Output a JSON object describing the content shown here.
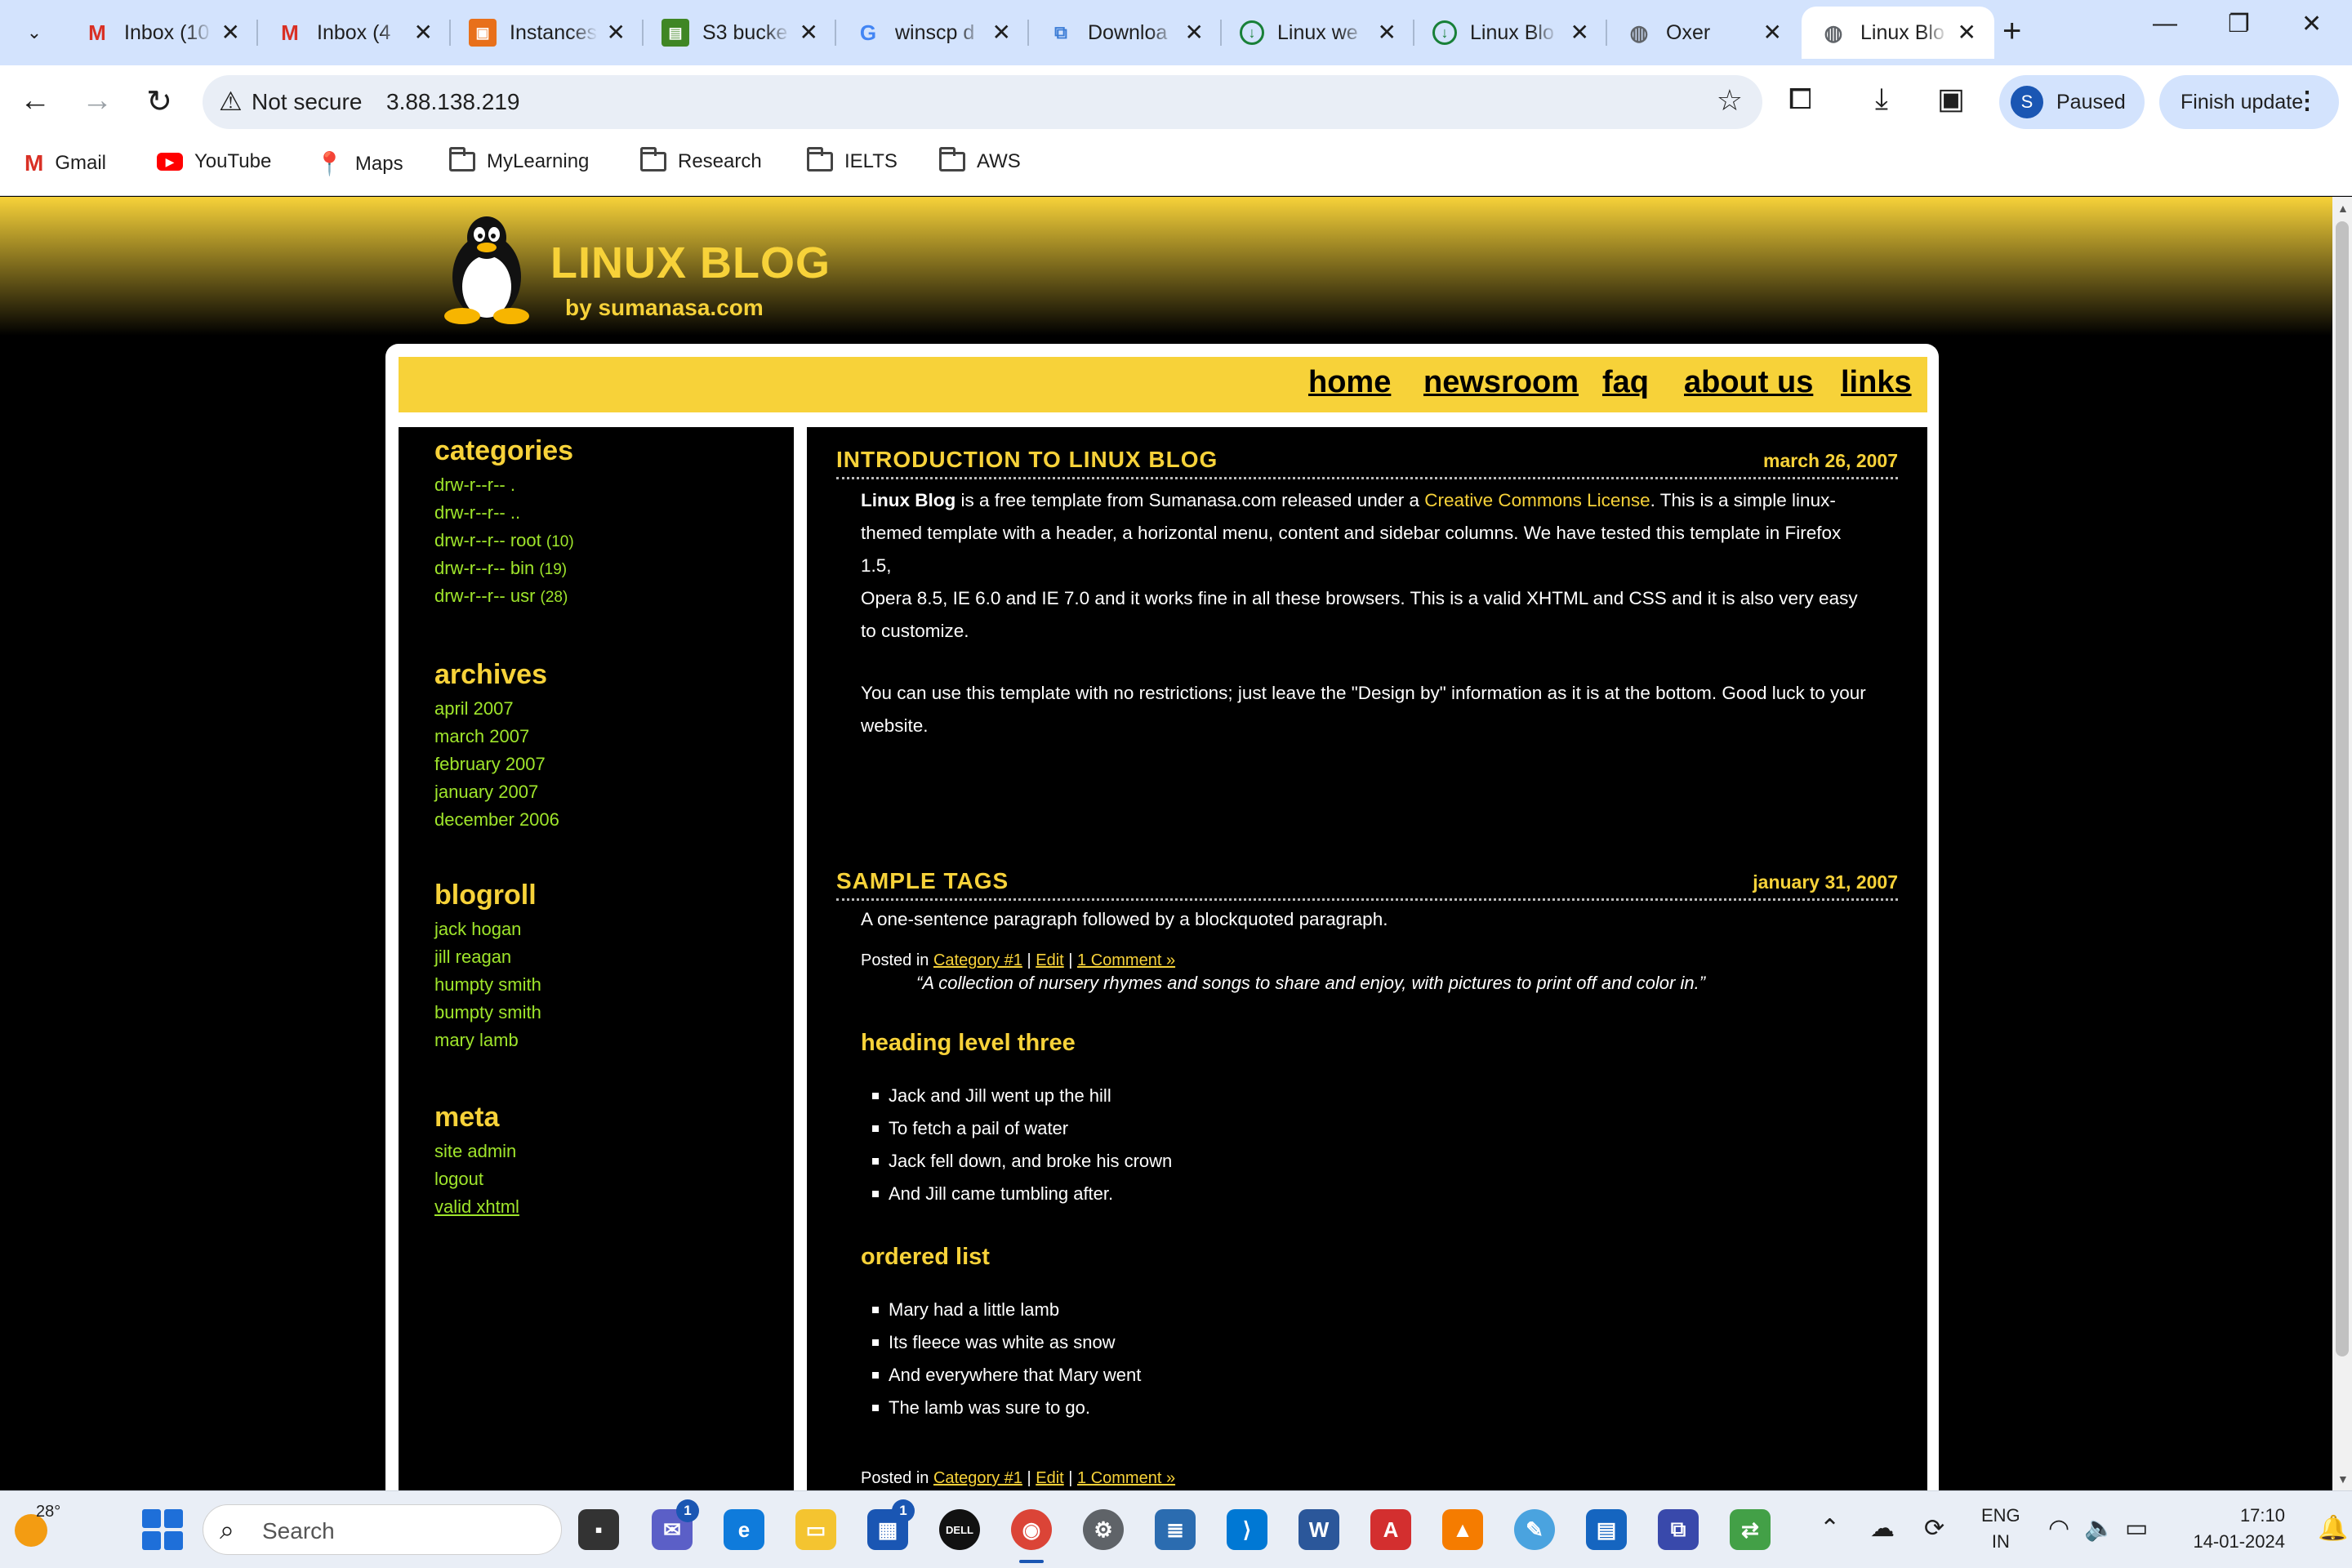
{
  "browser": {
    "tabs": [
      {
        "title": "Inbox (10",
        "icon": "gmail-icon"
      },
      {
        "title": "Inbox (4",
        "icon": "gmail-icon"
      },
      {
        "title": "Instances",
        "icon": "aws-ec2-icon"
      },
      {
        "title": "S3 bucke",
        "icon": "aws-s3-icon"
      },
      {
        "title": "winscp d",
        "icon": "google-icon"
      },
      {
        "title": "Downloa",
        "icon": "winscp-icon"
      },
      {
        "title": "Linux we",
        "icon": "download-icon"
      },
      {
        "title": "Linux Blo",
        "icon": "download-icon"
      },
      {
        "title": "Oxer",
        "icon": "globe-icon"
      },
      {
        "title": "Linux Blo",
        "icon": "globe-icon"
      }
    ],
    "address": {
      "security": "Not secure",
      "url": "3.88.138.219"
    },
    "profile": {
      "initial": "S",
      "status": "Paused"
    },
    "update_label": "Finish update",
    "bookmarks": [
      "Gmail",
      "YouTube",
      "Maps",
      "MyLearning",
      "Research",
      "IELTS",
      "AWS"
    ]
  },
  "site": {
    "title": "LINUX BLOG",
    "subtitle": "by sumanasa.com",
    "menu": [
      "home",
      "newsroom",
      "faq",
      "about us",
      "links"
    ],
    "sidebar": {
      "categories": {
        "heading": "categories",
        "items": [
          {
            "label": "drw-r--r-- .",
            "count": ""
          },
          {
            "label": "drw-r--r-- ..",
            "count": ""
          },
          {
            "label": "drw-r--r-- root",
            "count": "(10)"
          },
          {
            "label": "drw-r--r-- bin",
            "count": "(19)"
          },
          {
            "label": "drw-r--r-- usr",
            "count": "(28)"
          }
        ]
      },
      "archives": {
        "heading": "archives",
        "items": [
          "april 2007",
          "march 2007",
          "february 2007",
          "january 2007",
          "december 2006"
        ]
      },
      "blogroll": {
        "heading": "blogroll",
        "items": [
          "jack hogan",
          "jill reagan",
          "humpty smith",
          "bumpty smith",
          "mary lamb"
        ]
      },
      "meta": {
        "heading": "meta",
        "items": [
          "site admin",
          "logout",
          "valid xhtml"
        ]
      }
    },
    "posts": [
      {
        "title": "INTRODUCTION TO LINUX BLOG",
        "date": "march 26, 2007",
        "p1_strong": "Linux Blog",
        "p1_a": " is a free template from Sumanasa.com released under a ",
        "p1_link": "Creative Commons License",
        "p1_b1": ". This is a simple linux-",
        "p1_b2": "themed template with a header, a horizontal menu, content and sidebar columns. We have tested this template in Firefox 1.5,",
        "p1_b3": "Opera 8.5, IE 6.0 and IE 7.0 and it works fine in all these browsers. This is a valid XHTML and CSS and it is also very easy",
        "p1_b4": "to customize.",
        "p2_l1": "You can use this template with no restrictions; just leave the \"Design by\" information as it is at the bottom. Good luck to your",
        "p2_l2": "website.",
        "meta": {
          "prefix": "Posted in ",
          "category": "Category #1",
          "sep": " | ",
          "edit": "Edit",
          "comment": "1 Comment »"
        }
      },
      {
        "title": "SAMPLE TAGS",
        "date": "january 31, 2007",
        "intro": "A one-sentence paragraph followed by a blockquoted paragraph.",
        "quote": "“A collection of nursery rhymes and songs to share and enjoy, with pictures to print off and color in.”",
        "h3a": "heading level three",
        "list1": [
          "Jack and Jill went up the hill",
          "To fetch a pail of water",
          "Jack fell down, and broke his crown",
          "And Jill came tumbling after."
        ],
        "h3b": "ordered list",
        "list2": [
          "Mary had a little lamb",
          "Its fleece was white as snow",
          "And everywhere that Mary went",
          "The lamb was sure to go."
        ],
        "meta": {
          "prefix": "Posted in ",
          "category": "Category #1",
          "sep": " | ",
          "edit": "Edit",
          "comment": "1 Comment »"
        }
      }
    ]
  },
  "taskbar": {
    "weather": "28°",
    "search_placeholder": "Search",
    "badges": {
      "chat": "1",
      "store": "1"
    },
    "language": [
      "ENG",
      "IN"
    ],
    "time": "17:10",
    "date": "14-01-2024"
  },
  "colors": {
    "accent": "#f7d239",
    "sidebar_link": "#9fe52b",
    "chrome_tabstrip": "#d3e3fd"
  }
}
